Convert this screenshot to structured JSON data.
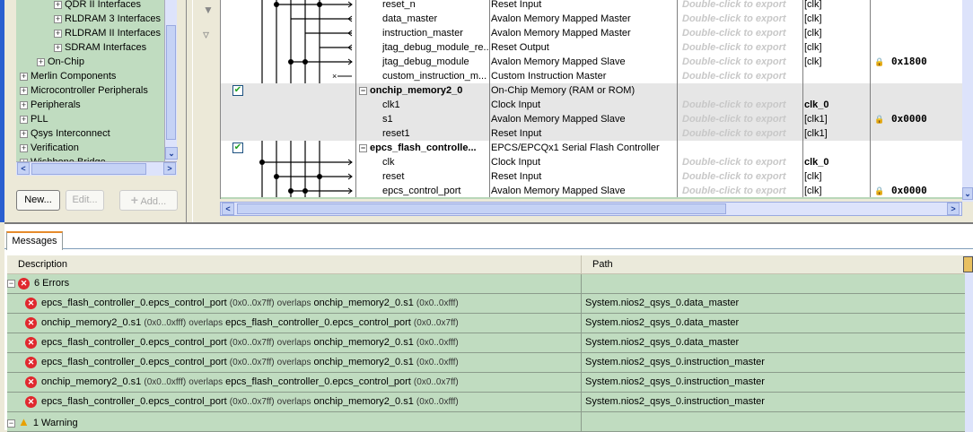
{
  "library_tree": {
    "items": [
      {
        "label": "QDR II Interfaces",
        "indent": 3
      },
      {
        "label": "RLDRAM 3 Interfaces",
        "indent": 3
      },
      {
        "label": "RLDRAM II Interfaces",
        "indent": 3
      },
      {
        "label": "SDRAM Interfaces",
        "indent": 3
      },
      {
        "label": "On-Chip",
        "indent": 2
      },
      {
        "label": "Merlin Components",
        "indent": 1
      },
      {
        "label": "Microcontroller Peripherals",
        "indent": 1
      },
      {
        "label": "Peripherals",
        "indent": 1
      },
      {
        "label": "PLL",
        "indent": 1
      },
      {
        "label": "Qsys Interconnect",
        "indent": 1
      },
      {
        "label": "Verification",
        "indent": 1
      },
      {
        "label": "Wishbone Bridge",
        "indent": 1
      }
    ]
  },
  "library_buttons": {
    "new": "New...",
    "edit": "Edit...",
    "add": "Add..."
  },
  "system_rows": [
    {
      "name": "reset_n",
      "desc": "Reset Input",
      "export": "Double-click to export",
      "clock": "[clk]",
      "base": "",
      "type": "port"
    },
    {
      "name": "data_master",
      "desc": "Avalon Memory Mapped Master",
      "export": "Double-click to export",
      "clock": "[clk]",
      "base": "",
      "type": "port"
    },
    {
      "name": "instruction_master",
      "desc": "Avalon Memory Mapped Master",
      "export": "Double-click to export",
      "clock": "[clk]",
      "base": "",
      "type": "port"
    },
    {
      "name": "jtag_debug_module_re...",
      "desc": "Reset Output",
      "export": "Double-click to export",
      "clock": "[clk]",
      "base": "",
      "type": "port"
    },
    {
      "name": "jtag_debug_module",
      "desc": "Avalon Memory Mapped Slave",
      "export": "Double-click to export",
      "clock": "[clk]",
      "base": "0x1800",
      "type": "port"
    },
    {
      "name": "custom_instruction_m...",
      "desc": "Custom Instruction Master",
      "export": "Double-click to export",
      "clock": "",
      "base": "",
      "type": "port"
    },
    {
      "name": "onchip_memory2_0",
      "desc": "On-Chip Memory (RAM or ROM)",
      "export": "",
      "clock": "",
      "base": "",
      "type": "module",
      "checked": true
    },
    {
      "name": "clk1",
      "desc": "Clock Input",
      "export": "Double-click to export",
      "clock": "clk_0",
      "base": "",
      "type": "port"
    },
    {
      "name": "s1",
      "desc": "Avalon Memory Mapped Slave",
      "export": "Double-click to export",
      "clock": "[clk1]",
      "base": "0x0000",
      "type": "port"
    },
    {
      "name": "reset1",
      "desc": "Reset Input",
      "export": "Double-click to export",
      "clock": "[clk1]",
      "base": "",
      "type": "port"
    },
    {
      "name": "epcs_flash_controlle...",
      "desc": "EPCS/EPCQx1 Serial Flash Controller",
      "export": "",
      "clock": "",
      "base": "",
      "type": "module",
      "checked": true
    },
    {
      "name": "clk",
      "desc": "Clock Input",
      "export": "Double-click to export",
      "clock": "clk_0",
      "base": "",
      "type": "port"
    },
    {
      "name": "reset",
      "desc": "Reset Input",
      "export": "Double-click to export",
      "clock": "[clk]",
      "base": "",
      "type": "port"
    },
    {
      "name": "epcs_control_port",
      "desc": "Avalon Memory Mapped Slave",
      "export": "Double-click to export",
      "clock": "[clk]",
      "base": "0x0000",
      "type": "port"
    }
  ],
  "messages": {
    "tab": "Messages",
    "col_description": "Description",
    "col_path": "Path",
    "errors_group": "6 Errors",
    "warning_group": "1 Warning",
    "errors": [
      {
        "a": "epcs_flash_controller_0.epcs_control_port",
        "ar": "(0x0..0x7ff)",
        "ov": "overlaps",
        "b": "onchip_memory2_0.s1",
        "br": "(0x0..0xfff)",
        "path": "System.nios2_qsys_0.data_master"
      },
      {
        "a": "onchip_memory2_0.s1",
        "ar": "(0x0..0xfff)",
        "ov": "overlaps",
        "b": "epcs_flash_controller_0.epcs_control_port",
        "br": "(0x0..0x7ff)",
        "path": "System.nios2_qsys_0.data_master"
      },
      {
        "a": "epcs_flash_controller_0.epcs_control_port",
        "ar": "(0x0..0x7ff)",
        "ov": "overlaps",
        "b": "onchip_memory2_0.s1",
        "br": "(0x0..0xfff)",
        "path": "System.nios2_qsys_0.data_master"
      },
      {
        "a": "epcs_flash_controller_0.epcs_control_port",
        "ar": "(0x0..0x7ff)",
        "ov": "overlaps",
        "b": "onchip_memory2_0.s1",
        "br": "(0x0..0xfff)",
        "path": "System.nios2_qsys_0.instruction_master"
      },
      {
        "a": "onchip_memory2_0.s1",
        "ar": "(0x0..0xfff)",
        "ov": "overlaps",
        "b": "epcs_flash_controller_0.epcs_control_port",
        "br": "(0x0..0x7ff)",
        "path": "System.nios2_qsys_0.instruction_master"
      },
      {
        "a": "epcs_flash_controller_0.epcs_control_port",
        "ar": "(0x0..0x7ff)",
        "ov": "overlaps",
        "b": "onchip_memory2_0.s1",
        "br": "(0x0..0xfff)",
        "path": "System.nios2_qsys_0.instruction_master"
      }
    ]
  },
  "colors": {
    "tree_bg": "#c0dcc0",
    "message_bg": "#c0dcc0",
    "error": "#e0282e",
    "module_row": "#e6e6e6"
  }
}
